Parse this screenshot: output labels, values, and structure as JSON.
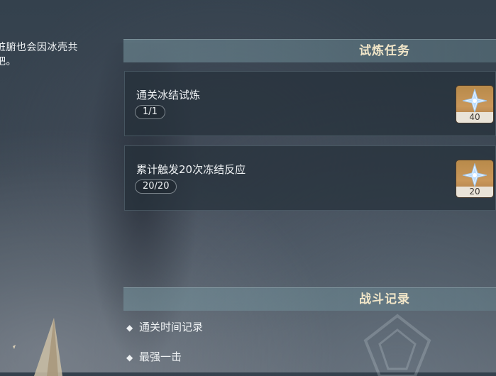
{
  "left_panel": {
    "description_lines": [
      "脏腑也会因冰壳共",
      "吧。"
    ]
  },
  "trial_tasks": {
    "header": "试炼任务",
    "tasks": [
      {
        "title": "通关冰结试炼",
        "progress": "1/1",
        "reward": {
          "icon": "primogem-icon",
          "quantity": "40"
        }
      },
      {
        "title": "累计触发20次冻结反应",
        "progress": "20/20",
        "reward": {
          "icon": "primogem-icon",
          "quantity": "20"
        }
      }
    ]
  },
  "combat_record": {
    "header": "战斗记录",
    "rows": [
      {
        "bullet": "◆",
        "label": "通关时间记录"
      },
      {
        "bullet": "◆",
        "label": "最强一击"
      }
    ]
  },
  "colors": {
    "header_text": "#f1e6c8",
    "reward_bg": "#c9975a",
    "panel_bg": "#26303a"
  }
}
